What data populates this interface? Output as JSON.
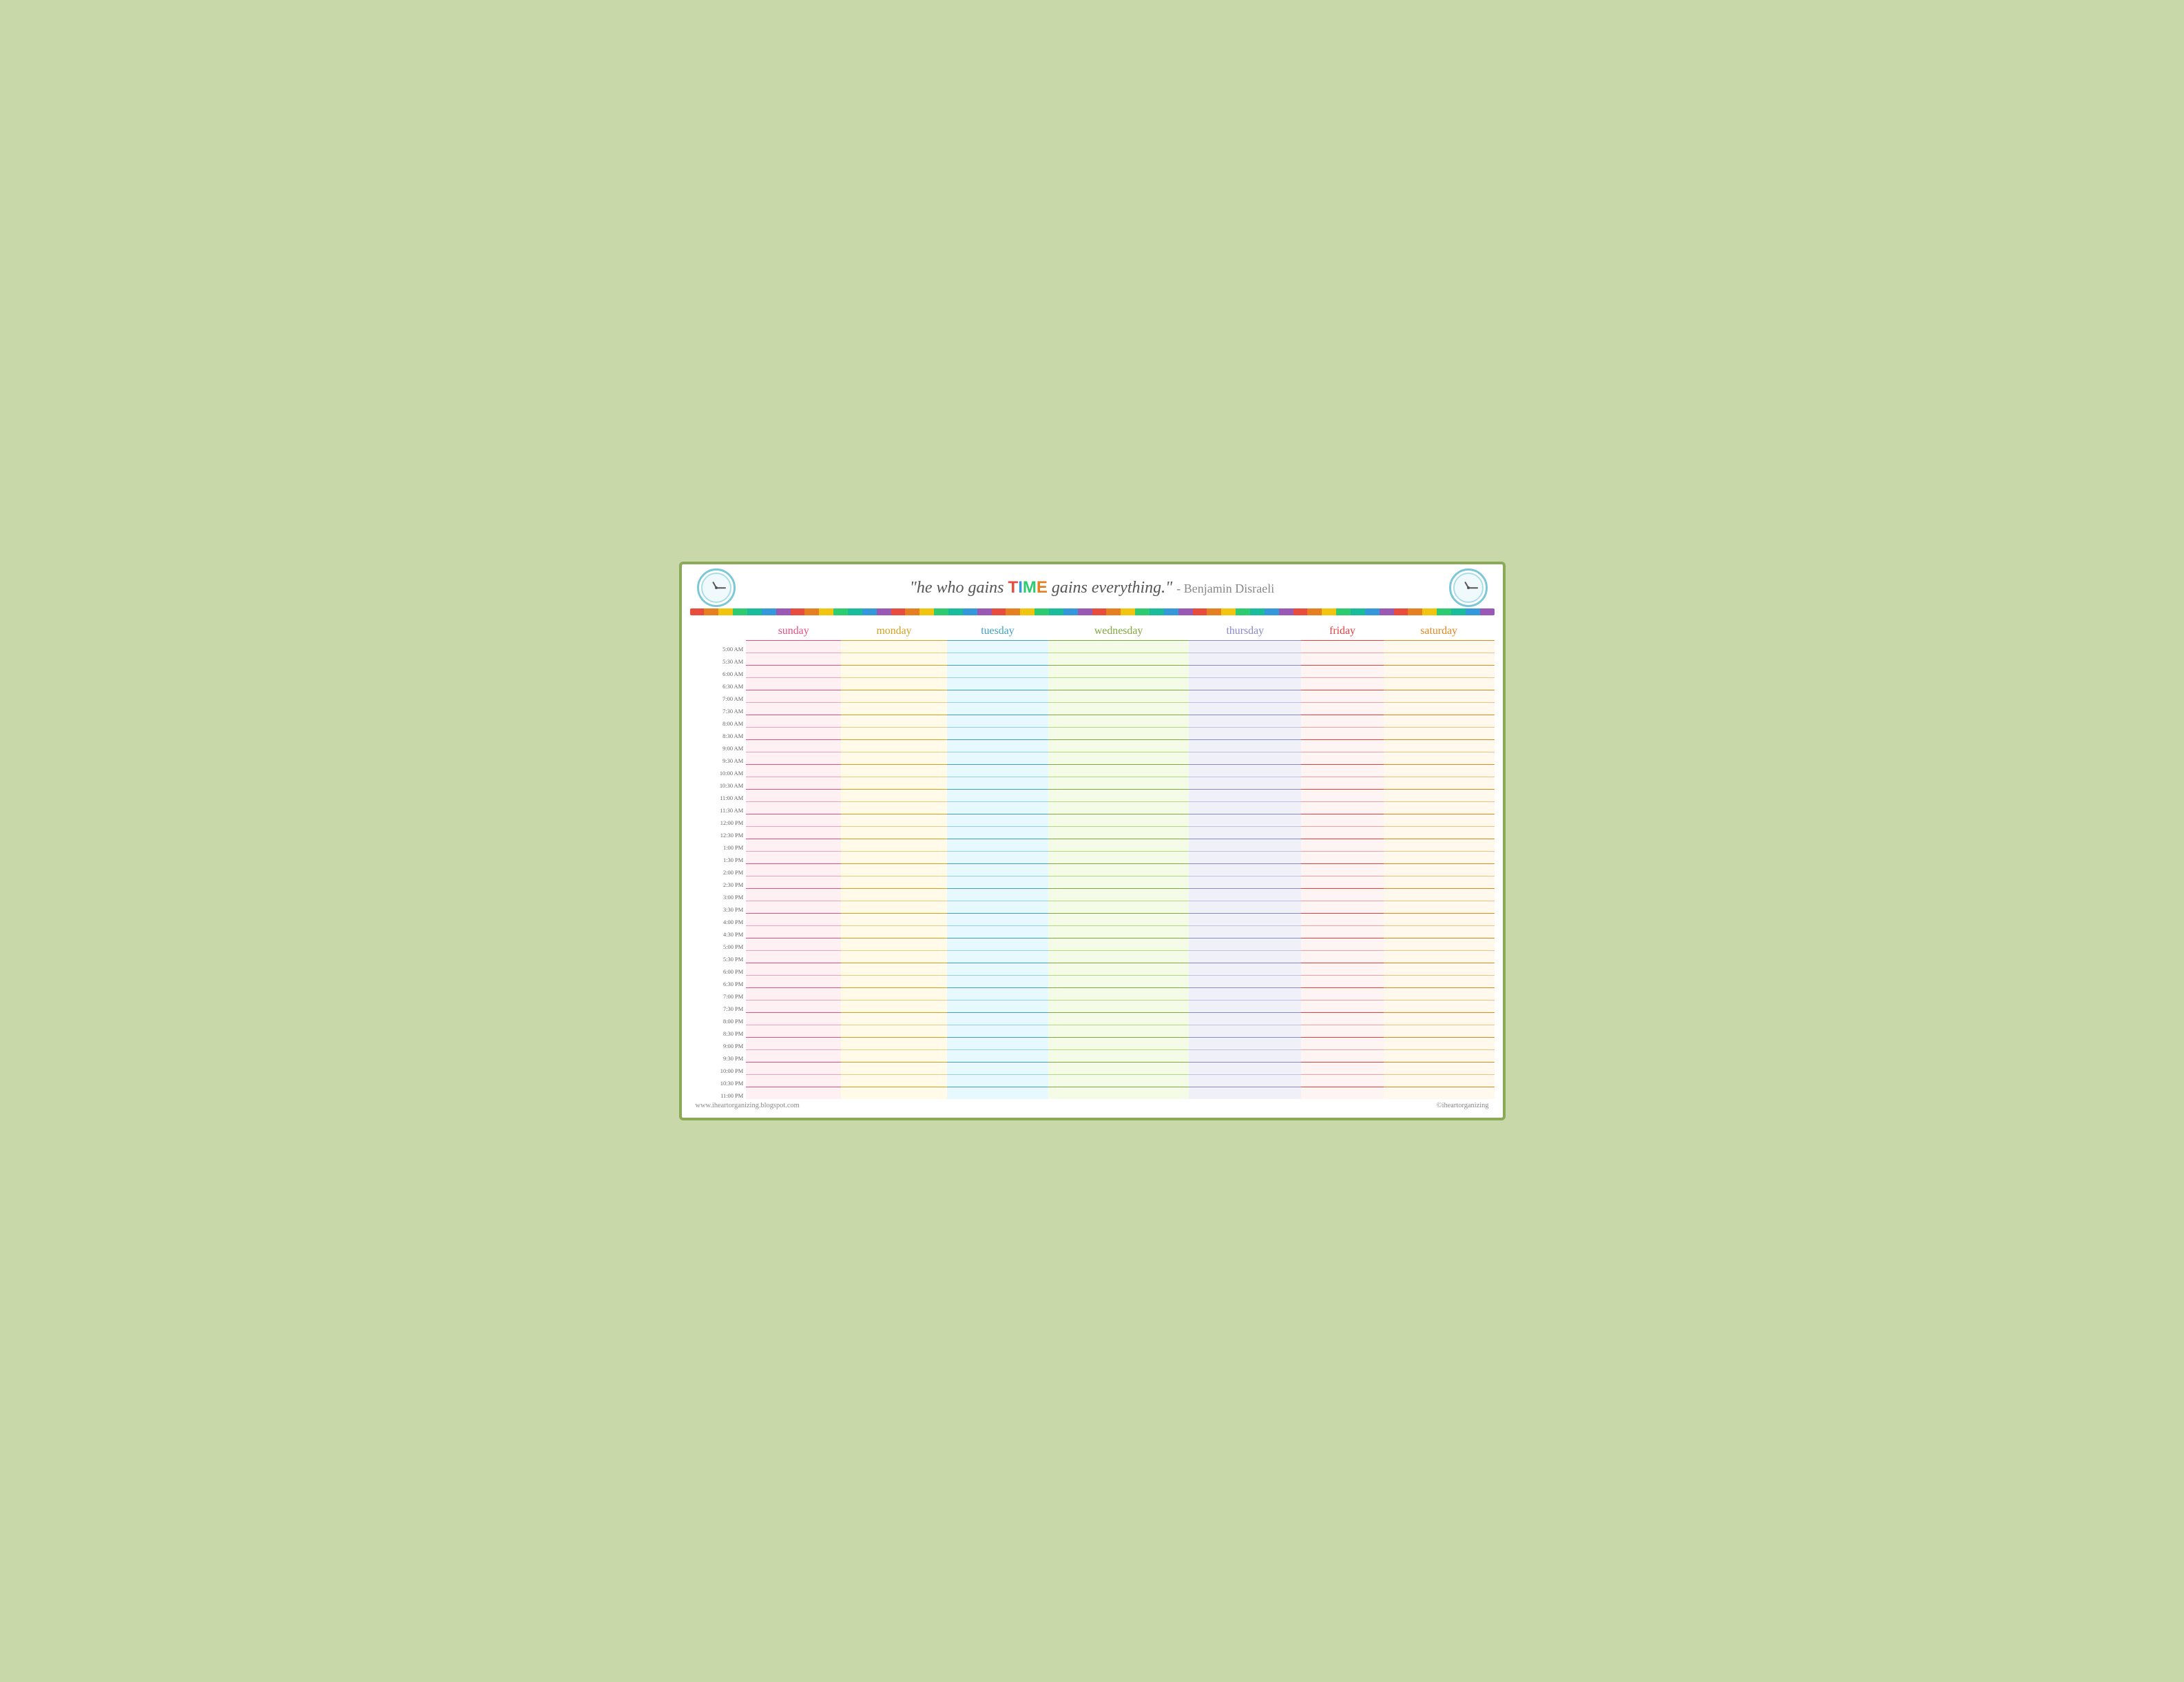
{
  "header": {
    "quote_before": "\"he who gains ",
    "quote_time": "TIME",
    "time_letters": {
      "t": "T",
      "i": "I",
      "m": "M",
      "e": "E"
    },
    "quote_after": " gains everything.\"",
    "attribution": "- Benjamin Disraeli"
  },
  "days": {
    "sunday": "sunday",
    "monday": "monday",
    "tuesday": "tuesday",
    "wednesday": "wednesday",
    "thursday": "thursday",
    "friday": "friday",
    "saturday": "saturday"
  },
  "times": [
    "5:00 AM",
    "5:30 AM",
    "6:00 AM",
    "6:30 AM",
    "7:00 AM",
    "7:30 AM",
    "8:00 AM",
    "8:30 AM",
    "9:00 AM",
    "9:30 AM",
    "10:00 AM",
    "10:30 AM",
    "11:00 AM",
    "11:30 AM",
    "12:00 PM",
    "12:30 PM",
    "1:00 PM",
    "1:30 PM",
    "2:00 PM",
    "2:30 PM",
    "3:00 PM",
    "3:30 PM",
    "4:00 PM",
    "4:30 PM",
    "5:00 PM",
    "5:30 PM",
    "6:00 PM",
    "6:30 PM",
    "7:00 PM",
    "7:30 PM",
    "8:00 PM",
    "8:30 PM",
    "9:00 PM",
    "9:30 PM",
    "10:00 PM",
    "10:30 PM",
    "11:00 PM"
  ],
  "rainbow_colors": [
    "#e74c3c",
    "#e67e22",
    "#f1c40f",
    "#2ecc71",
    "#1abc9c",
    "#3498db",
    "#9b59b6",
    "#e74c3c",
    "#e67e22",
    "#f1c40f",
    "#2ecc71",
    "#1abc9c",
    "#3498db",
    "#9b59b6",
    "#e74c3c",
    "#e67e22",
    "#f1c40f",
    "#2ecc71",
    "#1abc9c",
    "#3498db",
    "#9b59b6",
    "#e74c3c",
    "#e67e22",
    "#f1c40f",
    "#2ecc71",
    "#1abc9c",
    "#3498db",
    "#9b59b6",
    "#e74c3c",
    "#e67e22",
    "#f1c40f",
    "#2ecc71",
    "#1abc9c",
    "#3498db",
    "#9b59b6",
    "#e74c3c",
    "#e67e22",
    "#f1c40f",
    "#2ecc71",
    "#1abc9c",
    "#3498db",
    "#9b59b6",
    "#e74c3c",
    "#e67e22",
    "#f1c40f",
    "#2ecc71",
    "#1abc9c",
    "#3498db",
    "#9b59b6",
    "#e74c3c",
    "#e67e22",
    "#f1c40f",
    "#2ecc71",
    "#1abc9c",
    "#3498db",
    "#9b59b6"
  ],
  "footer": {
    "website": "www.iheartorganizing.blogspot.com",
    "copyright": "©iheartorganizing"
  }
}
